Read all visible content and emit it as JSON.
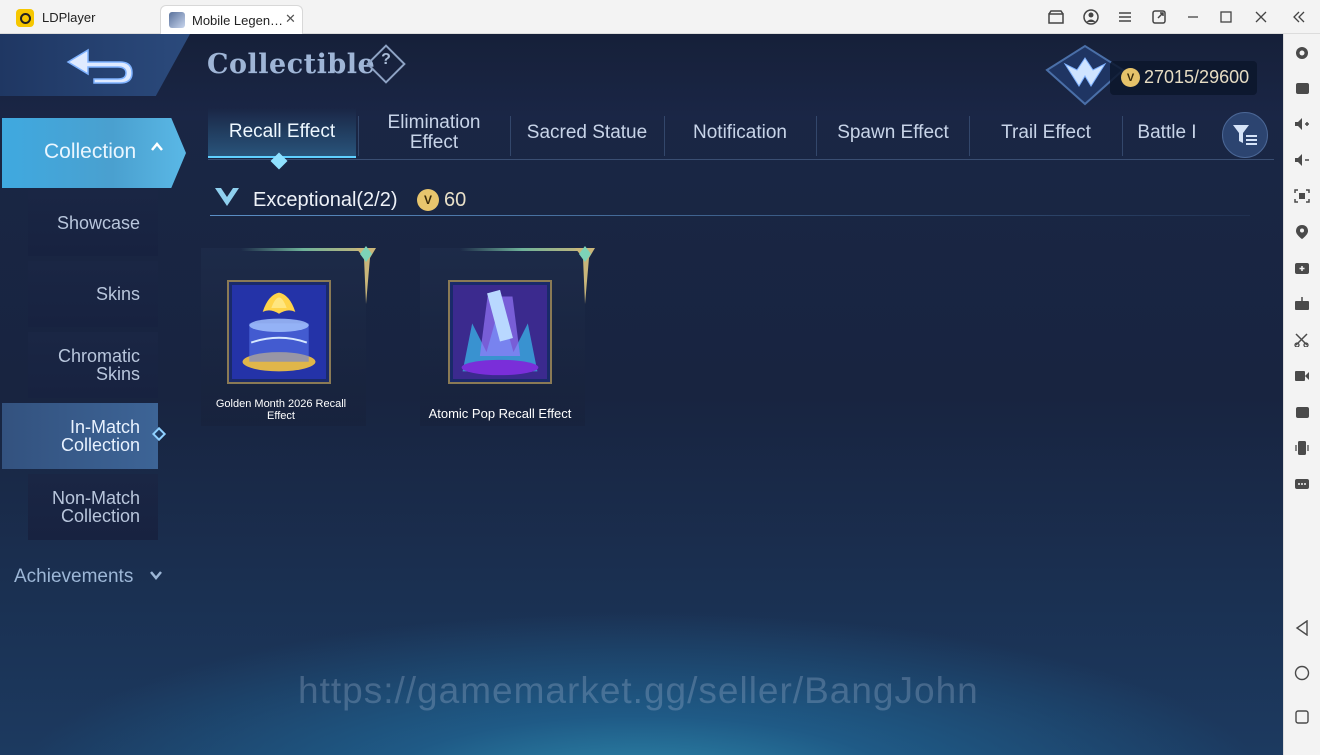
{
  "window": {
    "app_name": "LDPlayer",
    "tab_title": "Mobile Legen…",
    "tab_close": "✕",
    "controls": [
      "store-icon",
      "account-icon",
      "menu-icon",
      "popout-icon",
      "minimize-icon",
      "maximize-icon",
      "close-icon",
      "collapse-icon"
    ]
  },
  "toolbar_right": [
    "settings-icon",
    "keyboard-icon",
    "volume-up-icon",
    "volume-down-icon",
    "screenshot-icon",
    "location-icon",
    "add-app-icon",
    "apk-icon",
    "scissors-icon",
    "record-icon",
    "sync-icon",
    "shake-icon",
    "more-icon",
    "back-icon",
    "home-icon",
    "recents-icon"
  ],
  "header": {
    "title": "Collectible",
    "help": "?",
    "bp_icon": "V",
    "bp_value": "27015/29600"
  },
  "nav": {
    "collection": "Collection",
    "items": [
      {
        "label": "Showcase",
        "active": false
      },
      {
        "label": "Skins",
        "active": false
      },
      {
        "label": "Chromatic\nSkins",
        "active": false
      },
      {
        "label": "In-Match\nCollection",
        "active": true
      },
      {
        "label": "Non-Match\nCollection",
        "active": false
      }
    ],
    "achievements": "Achievements"
  },
  "tabs": [
    {
      "label": "Recall Effect",
      "active": true
    },
    {
      "label": "Elimination\nEffect",
      "active": false
    },
    {
      "label": "Sacred Statue",
      "active": false
    },
    {
      "label": "Notification",
      "active": false
    },
    {
      "label": "Spawn Effect",
      "active": false
    },
    {
      "label": "Trail Effect",
      "active": false
    },
    {
      "label": "Battle I",
      "active": false
    }
  ],
  "section": {
    "title": "Exceptional(2/2)",
    "coin_icon": "V",
    "count": "60"
  },
  "items": [
    {
      "name": "Golden Month 2026 Recall Effect"
    },
    {
      "name": "Atomic Pop Recall Effect"
    }
  ],
  "watermark": "https://gamemarket.gg/seller/BangJohn",
  "colors": {
    "accent_cyan": "#5fd0ff",
    "collection_blue": "#3fa9e0",
    "gold": "#e6c36a",
    "bg_navy": "#1a2746"
  }
}
